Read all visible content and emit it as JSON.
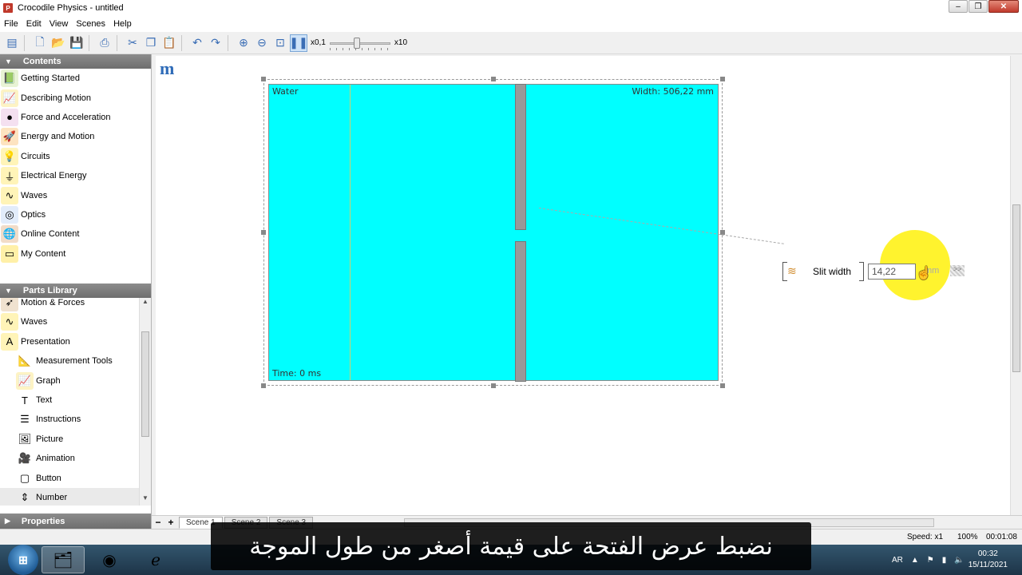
{
  "window": {
    "title": "Crocodile Physics - untitled"
  },
  "menu": [
    "File",
    "Edit",
    "View",
    "Scenes",
    "Help"
  ],
  "toolbar": {
    "speed_min": "x0,1",
    "speed_max": "x10",
    "speed_fraction": 0.45
  },
  "contents": {
    "header": "Contents",
    "items": [
      {
        "label": "Getting Started",
        "icon": "book-icon"
      },
      {
        "label": "Describing Motion",
        "icon": "graph-icon"
      },
      {
        "label": "Force and Acceleration",
        "icon": "ball-icon"
      },
      {
        "label": "Energy and Motion",
        "icon": "rocket-icon"
      },
      {
        "label": "Circuits",
        "icon": "bulb-icon"
      },
      {
        "label": "Electrical Energy",
        "icon": "resistor-icon"
      },
      {
        "label": "Waves",
        "icon": "wave-icon"
      },
      {
        "label": "Optics",
        "icon": "lens-icon"
      },
      {
        "label": "Online Content",
        "icon": "globe-icon"
      },
      {
        "label": "My Content",
        "icon": "folder-icon"
      }
    ]
  },
  "parts_library": {
    "header": "Parts Library",
    "items": [
      {
        "label": "Motion & Forces",
        "icon": "motion-icon",
        "sub": false
      },
      {
        "label": "Waves",
        "icon": "wave-icon",
        "sub": false
      },
      {
        "label": "Presentation",
        "icon": "letter-a-icon",
        "sub": false
      },
      {
        "label": "Measurement Tools",
        "icon": "ruler-icon",
        "sub": true
      },
      {
        "label": "Graph",
        "icon": "graph-icon",
        "sub": true
      },
      {
        "label": "Text",
        "icon": "text-icon",
        "sub": true
      },
      {
        "label": "Instructions",
        "icon": "list-icon",
        "sub": true
      },
      {
        "label": "Picture",
        "icon": "picture-icon",
        "sub": true
      },
      {
        "label": "Animation",
        "icon": "camera-icon",
        "sub": true
      },
      {
        "label": "Button",
        "icon": "button-icon",
        "sub": true
      },
      {
        "label": "Number",
        "icon": "spinner-icon",
        "sub": true
      }
    ]
  },
  "properties": {
    "header": "Properties"
  },
  "simulation": {
    "medium_label": "Water",
    "width_label": "Width: 506,22 mm",
    "time_label": "Time: 0 ms",
    "medium_color": "#00ffff"
  },
  "slit_control": {
    "label": "Slit width",
    "value": "14,22",
    "unit": "mm",
    "more": ">>"
  },
  "scenes": [
    "Scene 1",
    "Scene 2",
    "Scene 3"
  ],
  "status": {
    "speed": "Speed: x1",
    "zoom": "100%",
    "time": "00:01:08"
  },
  "subtitle": "نضبط عرض الفتحة على قيمة أصغر من طول الموجة",
  "taskbar": {
    "apps": [
      "folder-icon",
      "chrome-icon",
      "edge-icon"
    ],
    "language": "AR",
    "time": "00:32",
    "date": "15/11/2021"
  }
}
